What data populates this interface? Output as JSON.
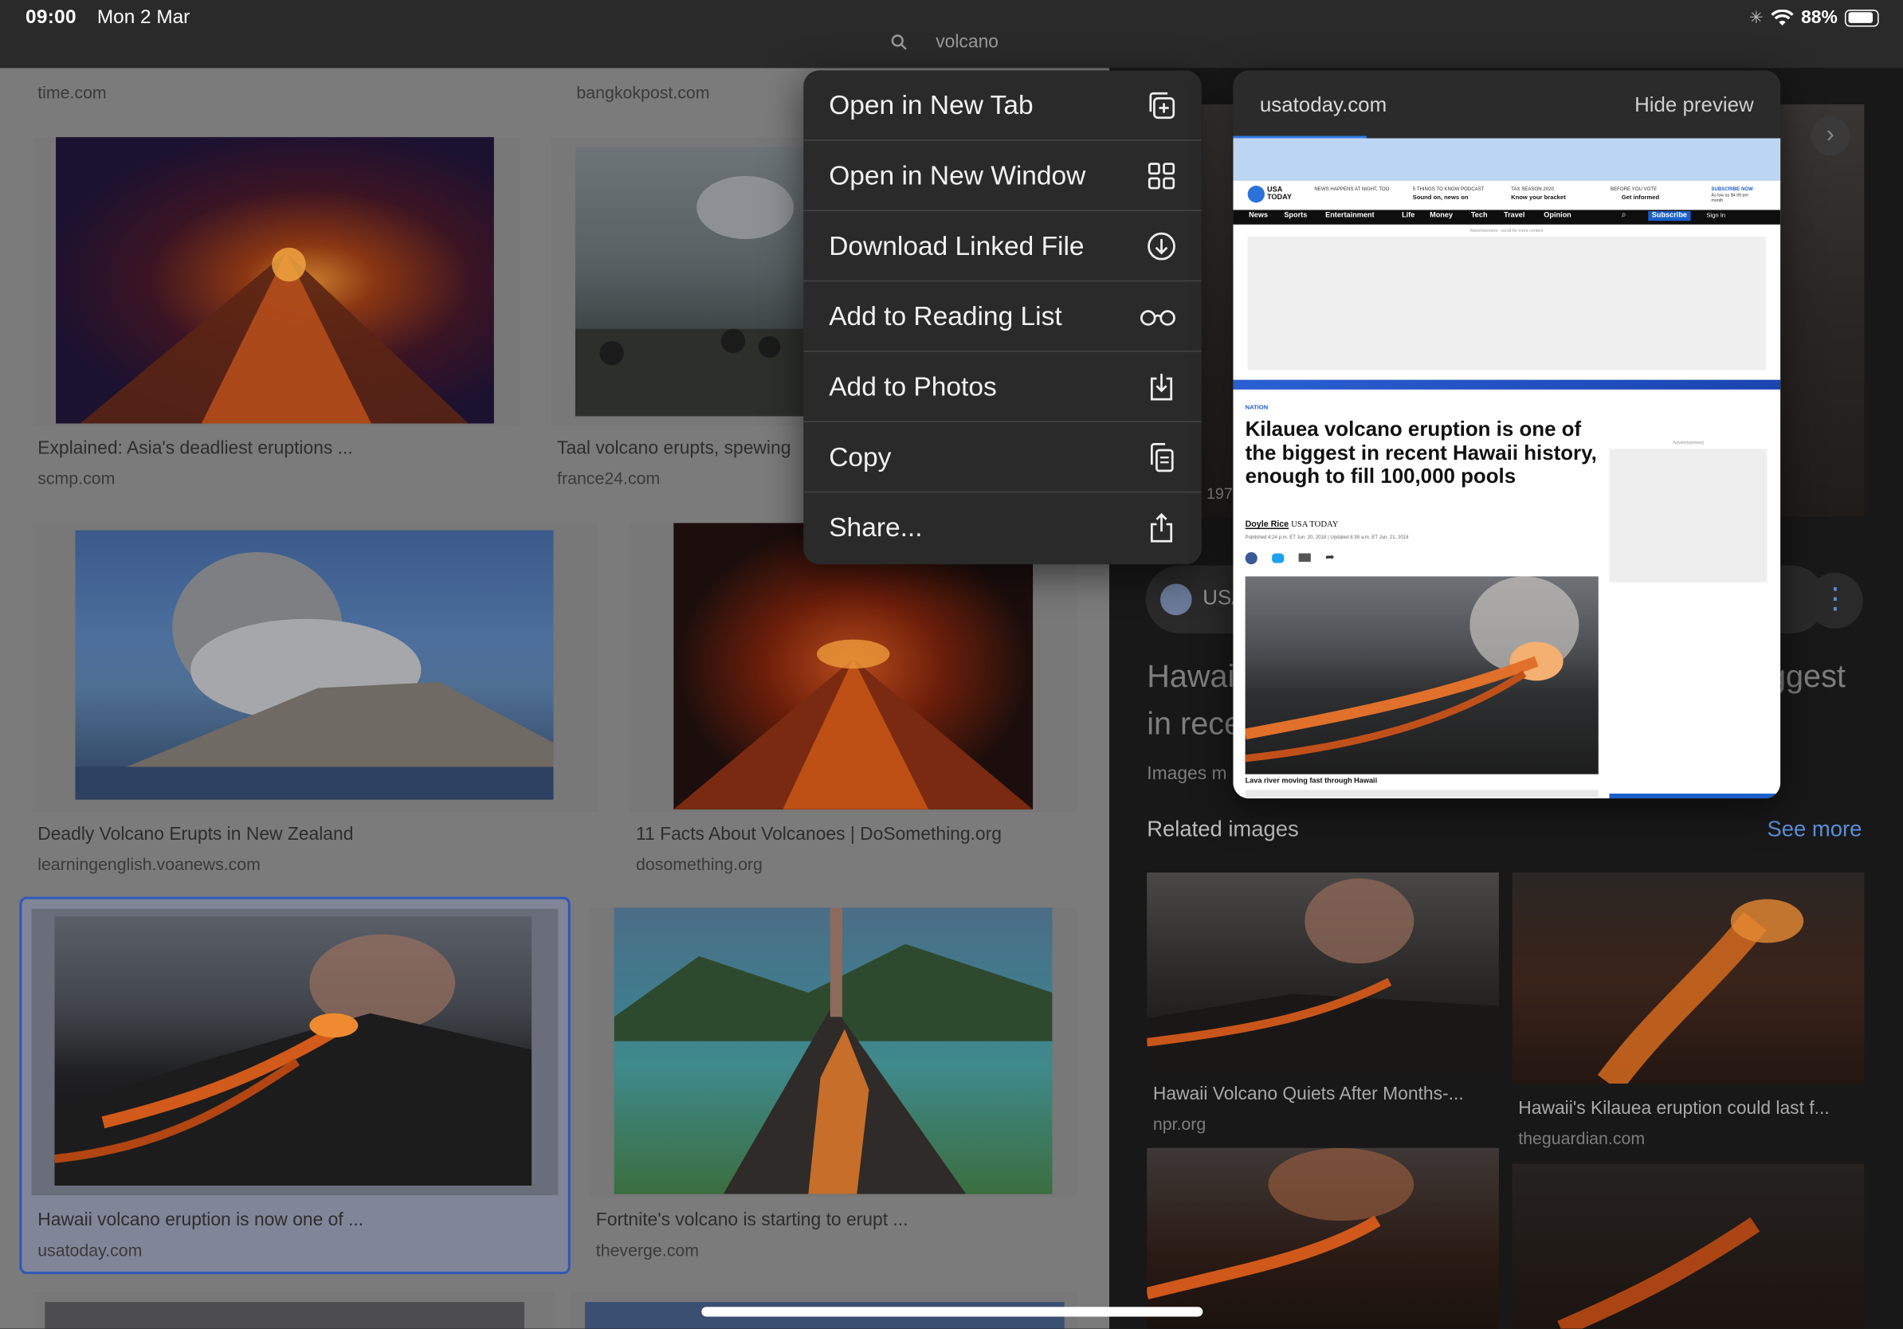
{
  "status_bar": {
    "time": "09:00",
    "date": "Mon 2 Mar",
    "battery": "88%"
  },
  "search": {
    "query": "volcano"
  },
  "grid": {
    "top_sources": [
      "time.com",
      "bangkokpost.com"
    ],
    "results": [
      {
        "caption": "Explained: Asia's deadliest eruptions ...",
        "source": "scmp.com"
      },
      {
        "caption": "Taal volcano erupts, spewing",
        "source": "france24.com"
      },
      {
        "caption": "Deadly Volcano Erupts in New Zealand",
        "source": "learningenglish.voanews.com"
      },
      {
        "caption": "11 Facts About Volcanoes | DoSomething.org",
        "source": "dosomething.org"
      },
      {
        "caption": "Hawaii volcano eruption is now one of ...",
        "source": "usatoday.com"
      },
      {
        "caption": "Fortnite's volcano is starting to erupt ...",
        "source": "theverge.com"
      }
    ]
  },
  "context_menu": {
    "items": [
      {
        "label": "Open in New Tab",
        "icon": "plus-square-icon"
      },
      {
        "label": "Open in New Window",
        "icon": "grid-icon"
      },
      {
        "label": "Download Linked File",
        "icon": "download-circle-icon"
      },
      {
        "label": "Add to Reading List",
        "icon": "glasses-icon"
      },
      {
        "label": "Add to Photos",
        "icon": "save-to-photos-icon"
      },
      {
        "label": "Copy",
        "icon": "copy-icon"
      },
      {
        "label": "Share...",
        "icon": "share-icon"
      }
    ]
  },
  "preview": {
    "host": "usatoday.com",
    "hide_label": "Hide preview",
    "site": {
      "logo": "USA TODAY",
      "promos": [
        "NEWS HAPPENS AT NIGHT, TOO",
        "5 THINGS TO KNOW PODCAST",
        "TAX SEASON 2020",
        "BEFORE YOU VOTE",
        "SUBSCRIBE NOW"
      ],
      "promo_subs": [
        "Sound on, news on",
        "Know your bracket",
        "Get informed",
        "As low as $4.99 per month"
      ],
      "nav": [
        "News",
        "Sports",
        "Entertainment",
        "Life",
        "Money",
        "Tech",
        "Travel",
        "Opinion"
      ],
      "subscribe": "Subscribe",
      "signin": "Sign In",
      "ad_label": "Advertisement - scroll for more content",
      "section": "NATION",
      "headline": "Kilauea volcano eruption is one of the biggest in recent Hawaii history, enough to fill 100,000 pools",
      "byline": "Doyle Rice",
      "outlet": "USA TODAY",
      "published": "Published 4:24 p.m. ET Jun. 20, 2018",
      "updated": "Updated 8:39 a.m. ET Jun. 21, 2018",
      "photo_caption": "Lava river moving fast through Hawaii",
      "side_ad": "Advertisement"
    }
  },
  "right_panel": {
    "year_stub": "197",
    "usa_stub": "USA",
    "title_left": "Hawai",
    "title_left2": "in rece",
    "title_right": "ggest",
    "images_stub": "Images m",
    "related_heading": "Related images",
    "see_more": "See more",
    "related": [
      {
        "caption": "Hawaii Volcano Quiets After Months-...",
        "source": "npr.org"
      },
      {
        "caption": "Hawaii's Kilauea eruption could last f...",
        "source": "theguardian.com"
      }
    ]
  }
}
